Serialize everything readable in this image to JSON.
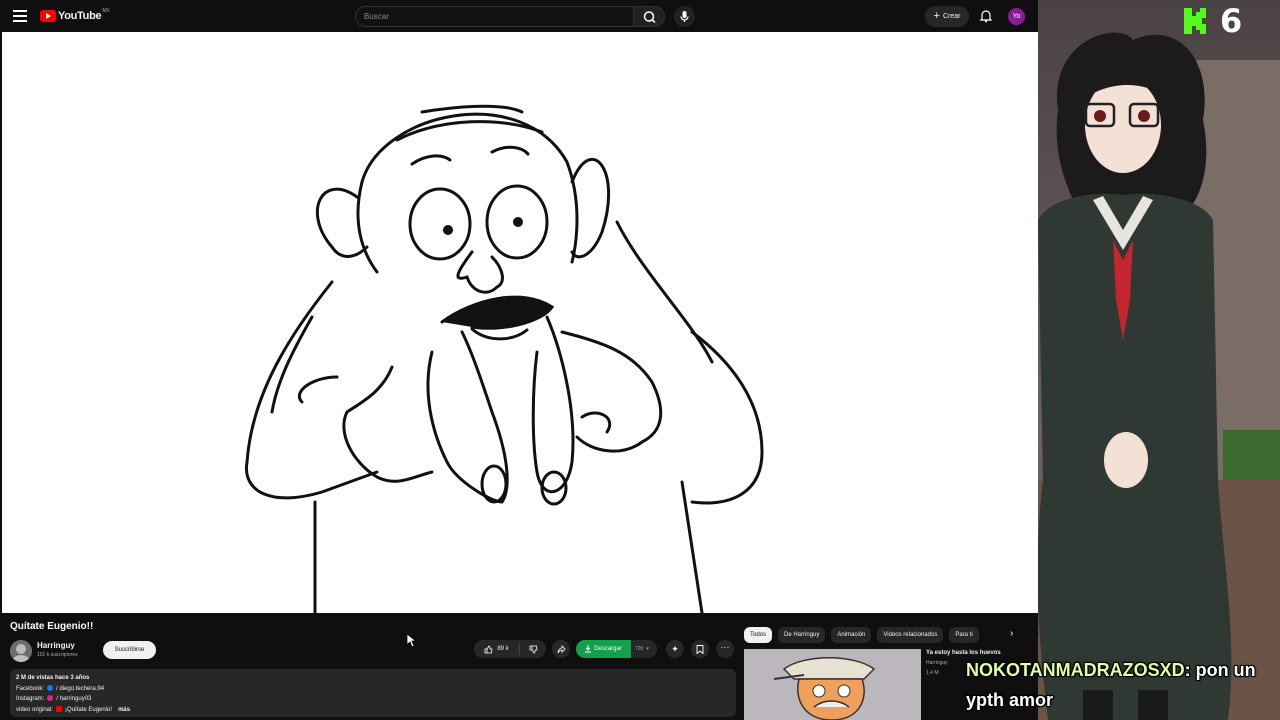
{
  "topbar": {
    "logo_text": "YouTube",
    "logo_region": "MX",
    "search_placeholder": "Buscar",
    "create_label": "Crear",
    "avatar_initials": "Yo"
  },
  "video": {
    "title": "Quítate Eugenio!!",
    "channel_name": "Harringuy",
    "subscribers": "101 k suscriptores",
    "subscribe_label": "Suscribirse",
    "likes": "89 k",
    "download_label": "Descargar",
    "download_quality": "720",
    "description": {
      "stats": "2 M de vistas  hace 3 años",
      "facebook_label": "Facebook:",
      "facebook_value": "/ diego.techera.94",
      "instagram_label": "Instagram:",
      "instagram_value": "/ harringuy03",
      "original_label": "video original:",
      "original_value": "¡Quítate Eugenio!",
      "more_label": "más"
    }
  },
  "related": {
    "chips": [
      "Todos",
      "De Harringuy",
      "Animación",
      "Videos relacionados",
      "Para ti"
    ],
    "item": {
      "title": "Ya estoy hasta los huevos",
      "channel": "Harringuy",
      "views": "1,4 M"
    }
  },
  "stream": {
    "counter": "6",
    "chat_user": "NOKOTANMADRAZOSXD",
    "chat_message": ": pon un ypth amor"
  },
  "colors": {
    "yt_red": "#ff0000",
    "download_green": "#12a04a",
    "chat_user": "#e3ffa4",
    "kick_green": "#53fc18"
  }
}
